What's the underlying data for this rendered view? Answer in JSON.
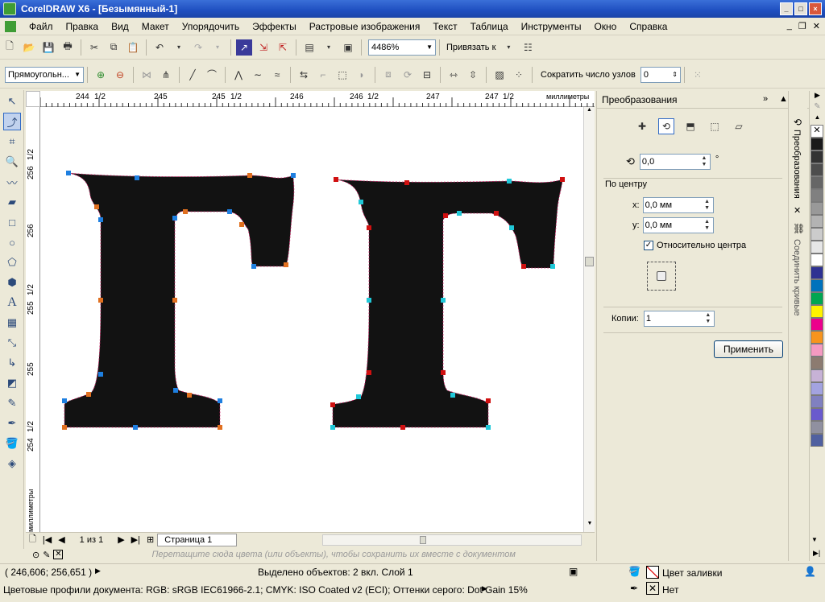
{
  "window": {
    "title": "CorelDRAW X6 - [Безымянный-1]"
  },
  "menu": [
    "Файл",
    "Правка",
    "Вид",
    "Макет",
    "Упорядочить",
    "Эффекты",
    "Растровые изображения",
    "Текст",
    "Таблица",
    "Инструменты",
    "Окно",
    "Справка"
  ],
  "toolbar1": {
    "zoom": "4486%",
    "snap_label": "Привязать к"
  },
  "toolbar2": {
    "shape_combo": "Прямоугольн...",
    "reduce_nodes_label": "Сократить число узлов",
    "reduce_nodes_value": "0"
  },
  "ruler": {
    "h_labels": [
      "244",
      "1/2",
      "245",
      "245",
      "1/2",
      "246",
      "246",
      "1/2",
      "247",
      "247",
      "1/2",
      "миллиметры"
    ],
    "v_labels": [
      "256",
      "1/2",
      "256",
      "255",
      "1/2",
      "255",
      "254",
      "1/2",
      "миллиметры"
    ]
  },
  "docker": {
    "title": "Преобразования",
    "angle_value": "0,0",
    "degree_sign": "°",
    "center_label": "По центру",
    "x_label": "x:",
    "x_value": "0,0 мм",
    "y_label": "y:",
    "y_value": "0,0 мм",
    "relative_label": "Относительно центра",
    "copies_label": "Копии:",
    "copies_value": "1",
    "apply_label": "Применить"
  },
  "vtabs": {
    "tab1": "Преобразования",
    "tab2": "Соединить кривые"
  },
  "page_nav": {
    "page_counter": "1 из 1",
    "page_tab": "Страница 1"
  },
  "palette_hint": "Перетащите сюда цвета (или объекты), чтобы сохранить их вместе с документом",
  "status": {
    "coords": "( 246,606; 256,651 )",
    "selection": "Выделено объектов: 2 вкл. Слой 1",
    "fill_label": "Цвет заливки",
    "outline_label": "Нет",
    "color_profiles": "Цветовые профили документа: RGB: sRGB IEC61966-2.1; CMYK: ISO Coated v2 (ECI); Оттенки серого: Dot Gain 15%"
  },
  "colors": {
    "palette": [
      "#1a1a1a",
      "#333333",
      "#4d4d4d",
      "#666666",
      "#808080",
      "#999999",
      "#b3b3b3",
      "#cccccc",
      "#e6e6e6",
      "#ffffff",
      "#2e3192",
      "#0072bc",
      "#00a651",
      "#fff200",
      "#ec008c",
      "#f7941d",
      "#f49ac1",
      "#8c7b70",
      "#c7b2d6",
      "#a3a3e0",
      "#8080c0",
      "#6a5acd",
      "#9090a0",
      "#5060a0"
    ],
    "glyph": "#121212",
    "node_blue": "#1e7fe0",
    "node_orange": "#e07020",
    "node_red": "#d01010",
    "node_cyan": "#20c8d8"
  }
}
